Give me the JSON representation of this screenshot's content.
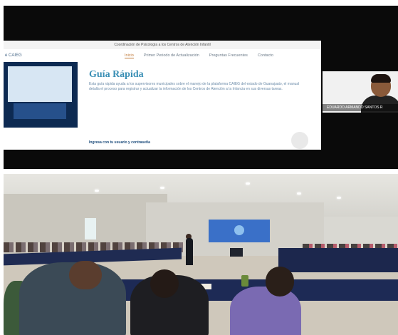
{
  "top_panel": {
    "slide": {
      "banner": "Coordinación de Psicología a los Centros de Atención Infantil",
      "brand": "e CAIEG",
      "nav": [
        "Inicio",
        "Primer Periodo de Actualización",
        "Preguntas Frecuentes",
        "Contacto"
      ],
      "title": "Guía Rápida",
      "paragraph": "Esta guía rápida ayuda a los supervisores municipales sobre el manejo de la plataforma CAIEG del estado de Guanajuato, el manual detalla el proceso para registrar y actualizar la información de los Centros de Atención a la Infancia en sus diversas tareas.",
      "footer": "Ingresa con tu usuario y contraseña"
    },
    "participant_name": "EDUARDO ARMANDO SANTOS R"
  },
  "colors": {
    "slide_title": "#3a8fb5",
    "projector_screen": "#3a70c8",
    "tables": "#1d2a55"
  }
}
